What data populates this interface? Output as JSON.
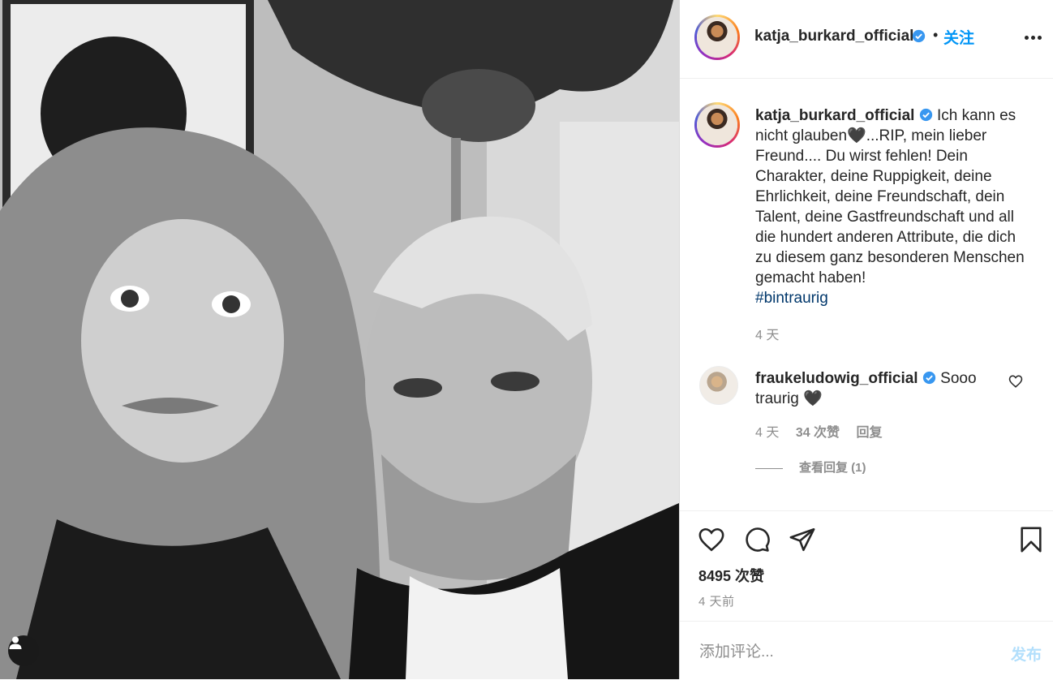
{
  "post": {
    "username": "katja_burkard_official",
    "follow_label": "关注",
    "dot": "•"
  },
  "caption": {
    "username": "katja_burkard_official",
    "text": "Ich kann es nicht glauben🖤...RIP, mein lieber Freund.... Du wirst fehlen! Dein Charakter, deine Ruppigkeit, deine Ehrlichkeit, deine Freundschaft, dein Talent, deine Gastfreundschaft und all die hundert anderen Attribute, die dich zu diesem ganz besonderen Menschen gemacht haben!",
    "hashtag": "#bintraurig",
    "time": "4 天"
  },
  "comment": {
    "username": "fraukeludowig_official",
    "text": "Sooo traurig 🖤",
    "time": "4 天",
    "likes": "34 次赞",
    "reply_label": "回复",
    "view_replies": "查看回复 (1)"
  },
  "actions": {
    "likes": "8495 次赞",
    "time": "4 天前"
  },
  "input": {
    "placeholder": "添加评论...",
    "post_label": "发布"
  },
  "colors": {
    "accent": "#0095f6",
    "hashtag": "#00376b",
    "muted": "#8e8e8e",
    "post_disabled": "#b2dffc"
  }
}
